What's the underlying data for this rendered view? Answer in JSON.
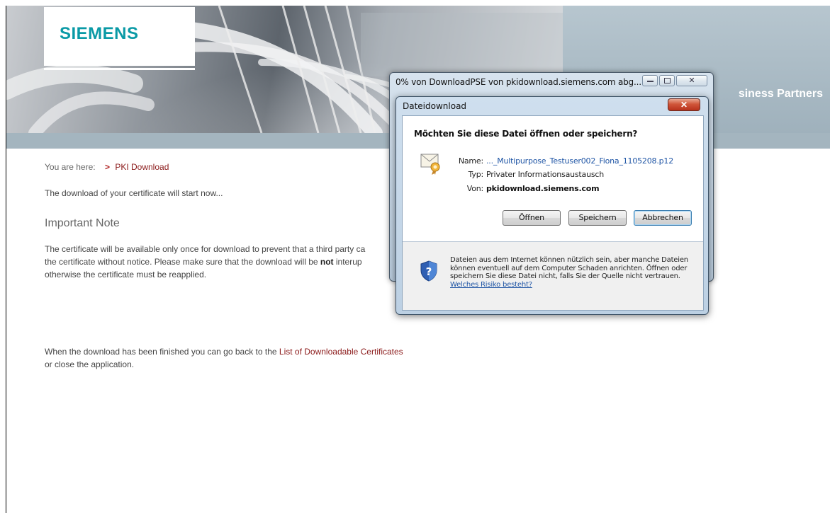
{
  "header": {
    "logo_text": "SIEMENS",
    "tagline": "siness Partners"
  },
  "breadcrumb": {
    "label": "You are here:",
    "chevron": ">",
    "current": "PKI Download"
  },
  "content": {
    "download_start": "The download of your certificate will start now...",
    "important_heading": "Important Note",
    "note_line1": "The certificate will be available only once for download to prevent that a third party ca",
    "note_line2_a": "the certificate without notice. Please make sure that the download will be ",
    "note_line2_bold": "not",
    "note_line2_b": " interup",
    "note_line3": "otherwise the certificate must be reapplied.",
    "finish_line1_a": "When the download has been finished you can go back to the ",
    "finish_link": "List of Downloadable Certificates",
    "finish_line2": "or close the application."
  },
  "progress_window": {
    "title": "0% von DownloadPSE von pkidownload.siemens.com abg...",
    "close_glyph": "✕"
  },
  "download_dialog": {
    "title": "Dateidownload",
    "close_glyph": "✕",
    "question": "Möchten Sie diese Datei öffnen oder speichern?",
    "name_label": "Name:",
    "name_value": "..._Multipurpose_Testuser002_Fiona_1105208.p12",
    "type_label": "Typ:",
    "type_value": "Privater Informationsaustausch",
    "from_label": "Von:",
    "from_value": "pkidownload.siemens.com",
    "open_button": "Öffnen",
    "save_button": "Speichern",
    "cancel_button": "Abbrechen",
    "warning_text": "Dateien aus dem Internet können nützlich sein, aber manche Dateien können eventuell auf dem Computer Schaden anrichten. Öffnen oder speichern Sie diese Datei nicht, falls Sie der Quelle nicht vertrauen. ",
    "risk_link": "Welches Risiko besteht?"
  },
  "icons": [
    "file-cert-icon",
    "shield-question-icon",
    "minimize-icon",
    "maximize-icon",
    "close-icon",
    "chevron-right-icon"
  ],
  "colors": {
    "siemens_teal": "#0a9aa6",
    "link_red": "#8b1a1a",
    "header_band": "#a4b5bf",
    "dialog_link_blue": "#1f55a5"
  }
}
